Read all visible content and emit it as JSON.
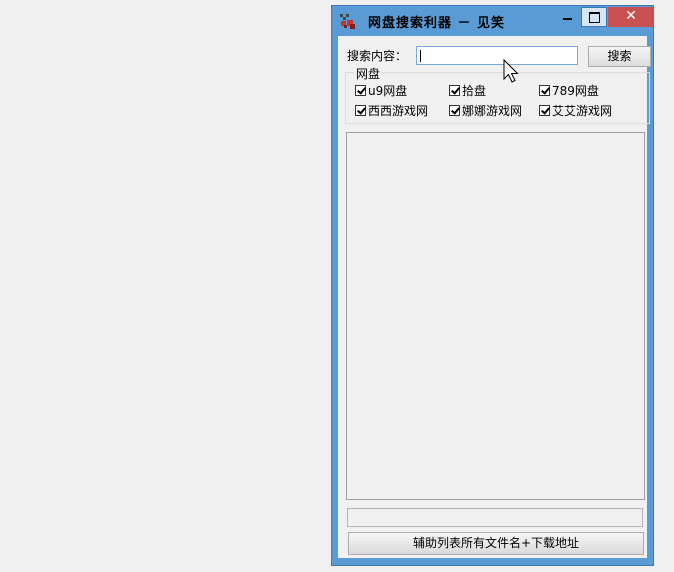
{
  "window": {
    "title": "网盘搜索利器 － 见笑",
    "close_glyph": "✕"
  },
  "search": {
    "label": "搜索内容：",
    "value": "",
    "button_label": "搜索"
  },
  "group": {
    "title": "网盘",
    "options": [
      {
        "label": "u9网盘",
        "checked": true
      },
      {
        "label": "拾盘",
        "checked": true
      },
      {
        "label": "789网盘",
        "checked": true
      },
      {
        "label": "西西游戏网",
        "checked": true
      },
      {
        "label": "娜娜游戏网",
        "checked": true
      },
      {
        "label": "艾艾游戏网",
        "checked": true
      }
    ]
  },
  "results": [],
  "status": "",
  "bottom_button_label": "辅助列表所有文件名+下载地址",
  "colors": {
    "titlebar": "#5b9bd5",
    "close_button": "#c75050",
    "input_border": "#7aa7d8"
  }
}
